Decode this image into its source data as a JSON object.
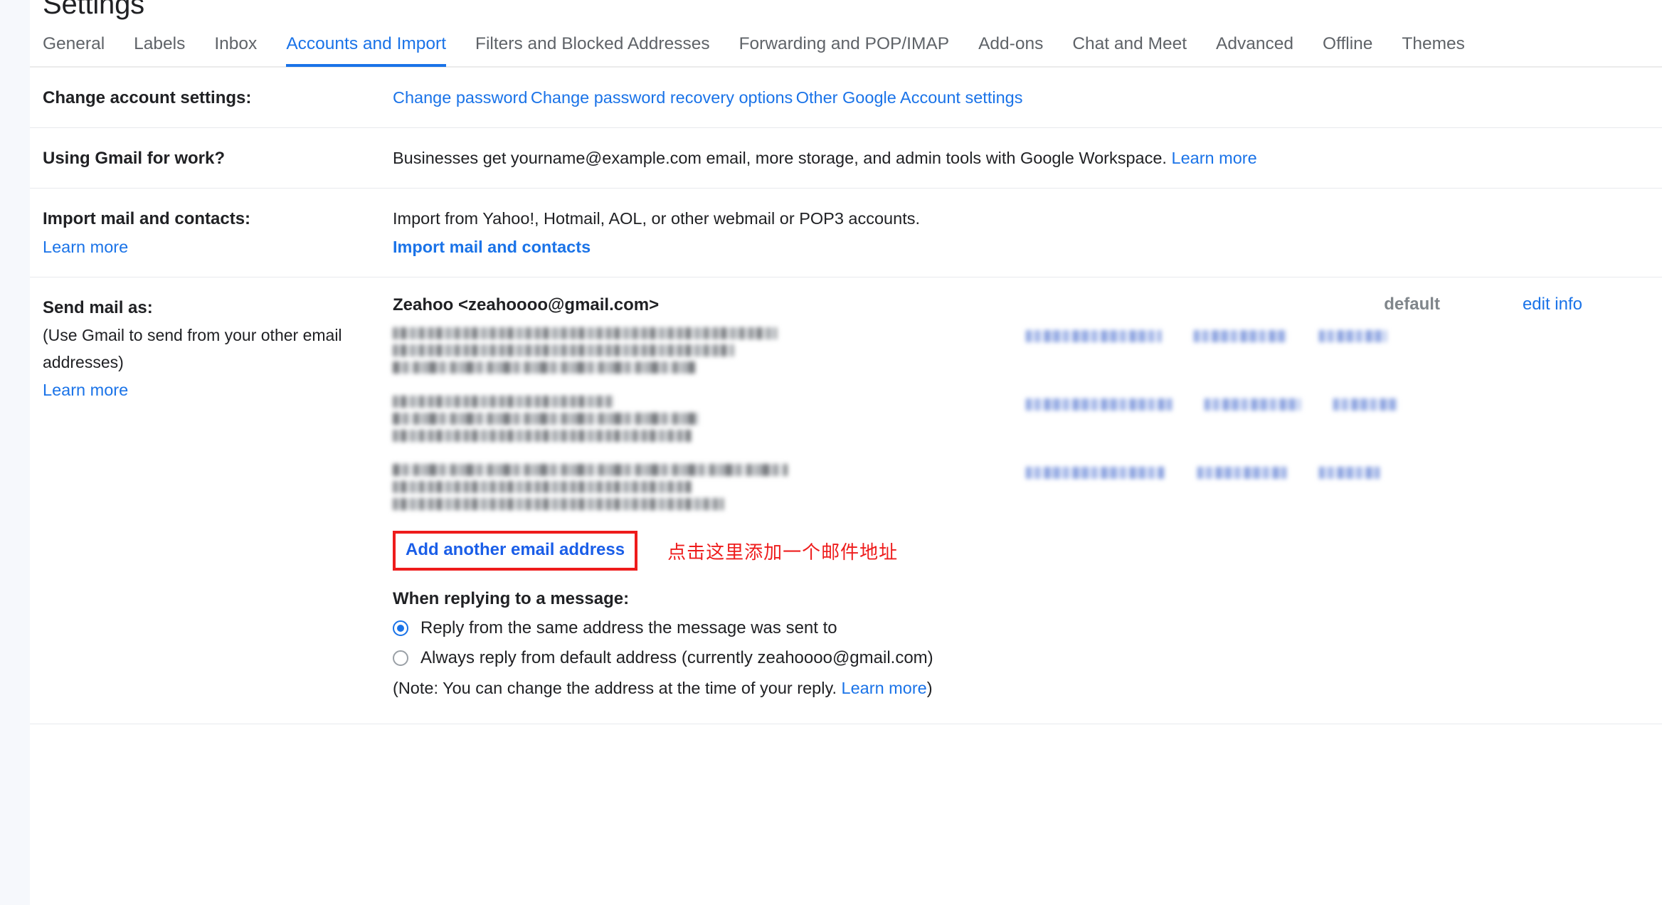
{
  "page": {
    "title": "Settings"
  },
  "tabs": [
    {
      "label": "General",
      "active": false
    },
    {
      "label": "Labels",
      "active": false
    },
    {
      "label": "Inbox",
      "active": false
    },
    {
      "label": "Accounts and Import",
      "active": true
    },
    {
      "label": "Filters and Blocked Addresses",
      "active": false
    },
    {
      "label": "Forwarding and POP/IMAP",
      "active": false
    },
    {
      "label": "Add-ons",
      "active": false
    },
    {
      "label": "Chat and Meet",
      "active": false
    },
    {
      "label": "Advanced",
      "active": false
    },
    {
      "label": "Offline",
      "active": false
    },
    {
      "label": "Themes",
      "active": false
    }
  ],
  "change_account": {
    "label": "Change account settings:",
    "links": [
      "Change password",
      "Change password recovery options",
      "Other Google Account settings"
    ]
  },
  "gmail_for_work": {
    "label": "Using Gmail for work?",
    "text": "Businesses get yourname@example.com email, more storage, and admin tools with Google Workspace.",
    "link": "Learn more"
  },
  "import": {
    "label": "Import mail and contacts:",
    "label_link": "Learn more",
    "text": "Import from Yahoo!, Hotmail, AOL, or other webmail or POP3 accounts.",
    "action_link": "Import mail and contacts"
  },
  "send_mail_as": {
    "label": "Send mail as:",
    "sublabel": "(Use Gmail to send from your other email addresses)",
    "label_link": "Learn more",
    "primary_address": "Zeahoo <zeahoooo@gmail.com>",
    "columns": {
      "default": "default",
      "edit_info": "edit info"
    },
    "entries": [
      {
        "redacted": true,
        "lines": 3,
        "widths": [
          540,
          480,
          425
        ],
        "actions": [
          190,
          130,
          95
        ]
      },
      {
        "redacted": true,
        "lines": 3,
        "widths": [
          310,
          430,
          420
        ],
        "actions": [
          205,
          135,
          90
        ]
      },
      {
        "redacted": true,
        "lines": 3,
        "widths": [
          555,
          420,
          465
        ],
        "actions": [
          195,
          125,
          85
        ]
      }
    ],
    "add_link": "Add another email address",
    "annotation": "点击这里添加一个邮件地址",
    "annotation_color": "#ee1c1c",
    "highlight_color": "#ee1c1c"
  },
  "when_replying": {
    "heading": "When replying to a message:",
    "options": [
      {
        "label": "Reply from the same address the message was sent to",
        "selected": true
      },
      {
        "label": "Always reply from default address (currently zeahoooo@gmail.com)",
        "selected": false
      }
    ],
    "note_prefix": "(Note: You can change the address at the time of your reply.",
    "note_link": "Learn more",
    "note_suffix": ")"
  },
  "colors": {
    "link_blue": "#1a73e8",
    "text": "#202124",
    "muted": "#5f6368",
    "divider": "#e8eaed",
    "gutter": "#f6f8fc",
    "alert_red": "#ee1c1c"
  }
}
